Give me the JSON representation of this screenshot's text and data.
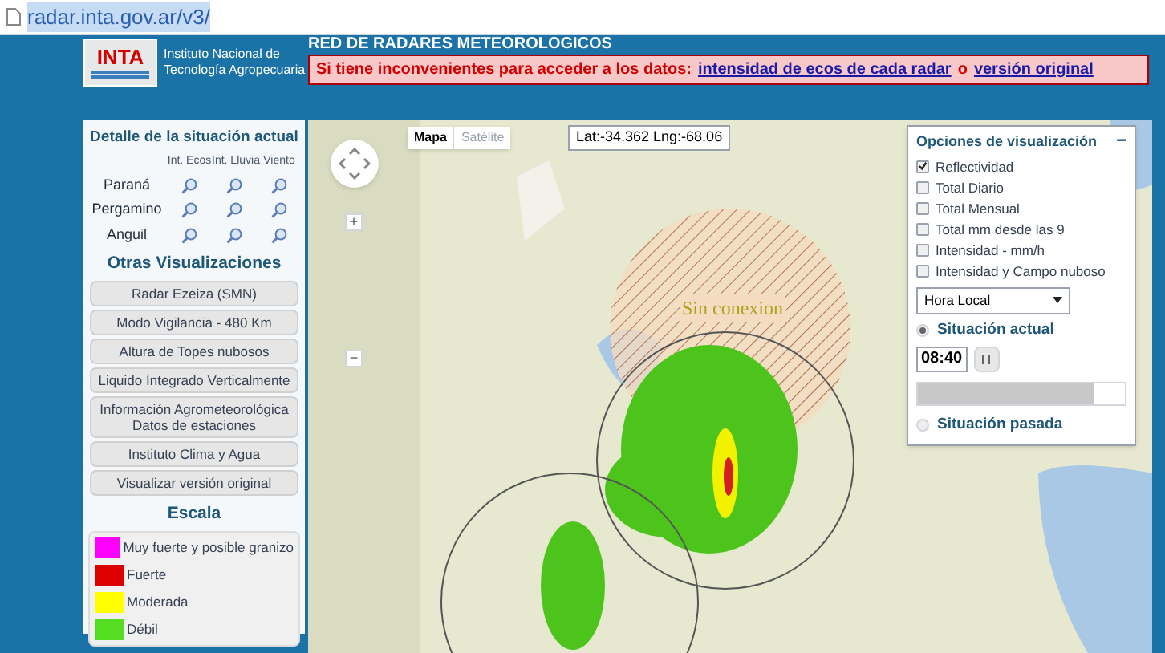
{
  "address_bar": {
    "url": "radar.inta.gov.ar/v3/"
  },
  "header": {
    "logo": "INTA",
    "institute": [
      "Instituto Nacional de",
      "Tecnología Agropecuaria"
    ],
    "title": "RED DE RADARES METEOROLOGICOS",
    "notice": "Si tiene inconvenientes para acceder a los datos:",
    "links": [
      "intensidad de ecos de cada radar",
      "versión original"
    ],
    "connector": "o"
  },
  "sidebar": {
    "detail_title": "Detalle de la situación actual",
    "columns": [
      "Int. Ecos",
      "Int. Lluvia",
      "Viento"
    ],
    "radars": [
      {
        "name": "Paraná"
      },
      {
        "name": "Pergamino"
      },
      {
        "name": "Anguil"
      }
    ],
    "other_title": "Otras Visualizaciones",
    "buttons": [
      [
        "Radar Ezeiza (SMN)"
      ],
      [
        "Modo Vigilancia - 480 Km"
      ],
      [
        "Altura de Topes nubosos"
      ],
      [
        "Liquido Integrado Verticalmente"
      ],
      [
        "Información Agrometeorológica",
        "Datos de estaciones"
      ],
      [
        "Instituto Clima y Agua"
      ],
      [
        "Visualizar versión original"
      ]
    ],
    "scale_title": "Escala",
    "legend": [
      {
        "label": "Muy fuerte y posible granizo",
        "color": "#ff00ff"
      },
      {
        "label": "Fuerte",
        "color": "#dd0000"
      },
      {
        "label": "Moderada",
        "color": "#ffff00"
      },
      {
        "label": "Débil",
        "color": "#55dd22"
      }
    ]
  },
  "map": {
    "map_types": [
      {
        "label": "Mapa",
        "selected": true
      },
      {
        "label": "Satélite",
        "selected": false
      }
    ],
    "coordinates": "Lat:-34.362 Lng:-68.06",
    "zoom_in": "+",
    "zoom_out": "−",
    "overlay_label": "Sin conexion"
  },
  "options": {
    "title": "Opciones de visualización",
    "collapse": "−",
    "layers": [
      {
        "label": "Reflectividad",
        "checked": true
      },
      {
        "label": "Total Diario",
        "checked": false
      },
      {
        "label": "Total Mensual",
        "checked": false
      },
      {
        "label": "Total mm desde las 9",
        "checked": false
      },
      {
        "label": "Intensidad - mm/h",
        "checked": false
      },
      {
        "label": "Intensidad y Campo nuboso",
        "checked": false
      }
    ],
    "time_zone": "Hora Local",
    "modes": [
      {
        "label": "Situación actual",
        "selected": true
      },
      {
        "label": "Situación pasada",
        "selected": false
      }
    ],
    "time": "08:40",
    "progress": {
      "level": 0.85
    }
  }
}
